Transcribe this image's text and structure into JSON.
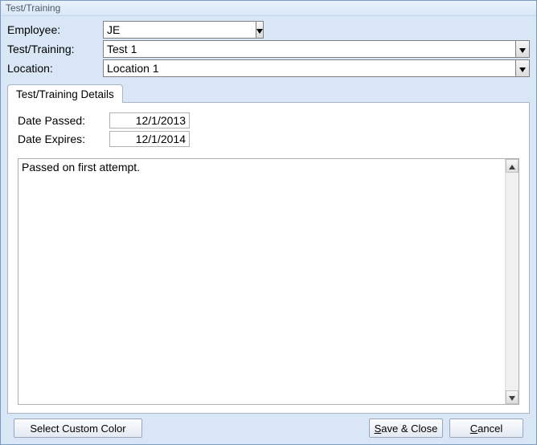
{
  "window": {
    "title": "Test/Training"
  },
  "form": {
    "employee_label": "Employee:",
    "employee_value": "JE",
    "testtraining_label": "Test/Training:",
    "testtraining_value": "Test 1",
    "location_label": "Location:",
    "location_value": "Location 1"
  },
  "tab": {
    "label": "Test/Training Details"
  },
  "details": {
    "date_passed_label": "Date Passed:",
    "date_passed_value": "12/1/2013",
    "date_expires_label": "Date Expires:",
    "date_expires_value": "12/1/2014",
    "notes": "Passed on first attempt."
  },
  "footer": {
    "select_color": "Select Custom Color",
    "save_close_prefix": "S",
    "save_close_rest": "ave & Close",
    "cancel_prefix": "C",
    "cancel_rest": "ancel"
  }
}
